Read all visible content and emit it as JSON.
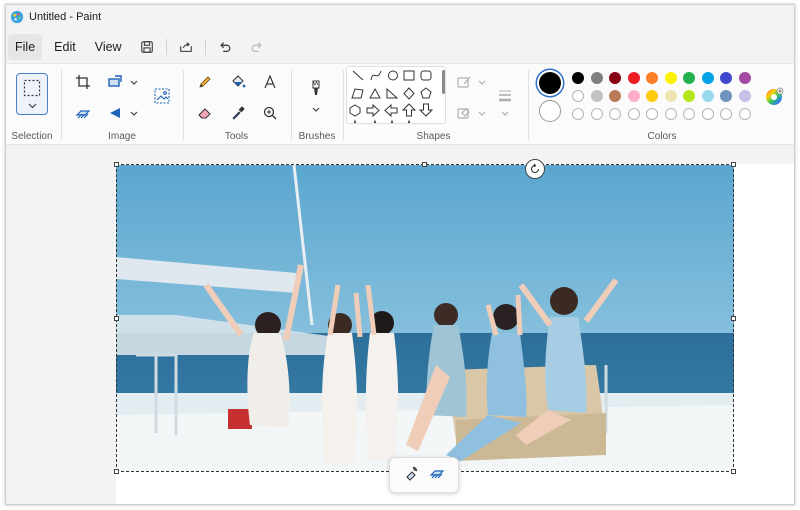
{
  "window": {
    "title": "Untitled - Paint"
  },
  "menu": {
    "file": "File",
    "edit": "Edit",
    "view": "View"
  },
  "ribbon": {
    "groups": {
      "selection": "Selection",
      "image": "Image",
      "tools": "Tools",
      "brushes": "Brushes",
      "shapes": "Shapes",
      "colors": "Colors"
    }
  },
  "colors": {
    "primary": "#000000",
    "secondary": "#ffffff",
    "palette_row1": [
      "#000000",
      "#7f7f7f",
      "#880015",
      "#ed1c24",
      "#ff7f27",
      "#fff200",
      "#22b14c",
      "#00a2e8",
      "#3f48cc",
      "#a349a4"
    ],
    "palette_row2": [
      "#ffffff",
      "#c3c3c3",
      "#b97a57",
      "#ffaec9",
      "#ffc90e",
      "#efe4b0",
      "#b5e61d",
      "#99d9ea",
      "#7092be",
      "#c8bfe7"
    ]
  },
  "icons": {
    "app": "paint-app-icon",
    "save": "save-icon",
    "share": "share-icon",
    "undo": "undo-icon",
    "redo": "redo-icon",
    "crop": "crop-icon",
    "resize": "resize-icon",
    "rotate": "rotate-icon",
    "remove_background": "remove-background-icon",
    "image_layer": "image-icon",
    "pencil": "pencil-icon",
    "fill": "fill-bucket-icon",
    "text": "text-icon",
    "eraser": "eraser-icon",
    "color_picker": "color-picker-icon",
    "magnifier": "magnifier-icon",
    "brush": "brush-icon",
    "outline": "outline-icon",
    "fill_shape": "shape-fill-icon",
    "size": "size-icon",
    "edit_colors": "color-wheel-icon"
  }
}
